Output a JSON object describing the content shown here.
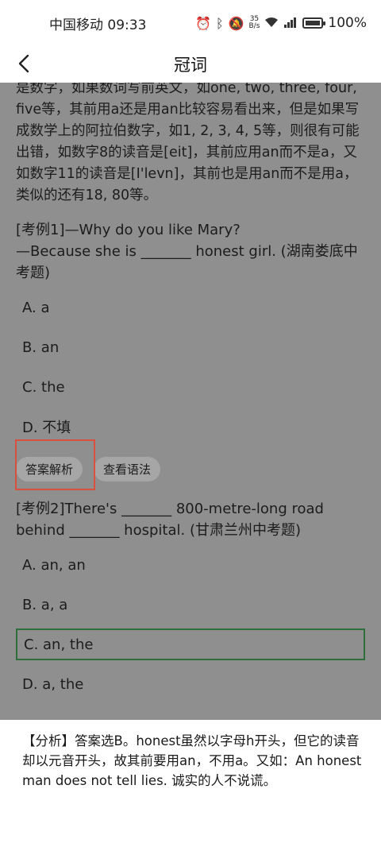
{
  "status": {
    "carrier_time": "中国移动 09:33",
    "net_speed_top": "35",
    "net_speed_bottom": "B/s",
    "battery": "100%",
    "battery_level": 1.0
  },
  "nav": {
    "title": "冠词"
  },
  "intro_text": "是数字，如果数词写前英文，如one, two, three, four, five等，其前用a还是用an比较容易看出来，但是如果写成数学上的阿拉伯数字，如1, 2, 3, 4, 5等，则很有可能出错，如数字8的读音是[eit]，其前应用an而不是a，又如数字11的读音是[I'levn]，其前也是用an而不是用a，类似的还有18, 80等。",
  "q1": {
    "line1": "[考例1]—Why do you like Mary?",
    "line2": "—Because she is _______ honest girl. (湖南娄底中考题)",
    "options": [
      "A. a",
      "B. an",
      "C. the",
      "D. 不填"
    ],
    "answer_btn": "答案解析",
    "grammar_btn": "查看语法"
  },
  "q2": {
    "text": "[考例2]There's _______ 800-metre-long road behind _______ hospital. (甘肃兰州中考题)",
    "options": [
      "A. an, an",
      "B. a, a",
      "C. an, the",
      "D. a, the"
    ]
  },
  "analysis": "【分析】答案选B。honest虽然以字母h开头，但它的读音却以元音开头，故其前要用an，不用a。又如：An honest man does not tell lies. 诚实的人不说谎。",
  "colors": {
    "overlay": "#8f8f8f",
    "selected_border": "#2f6e3b",
    "highlight": "#d9503f"
  }
}
